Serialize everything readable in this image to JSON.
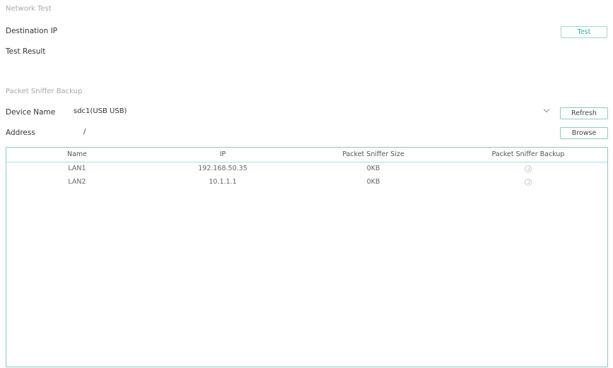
{
  "network_test": {
    "section_title": "Network Test",
    "destination_ip_label": "Destination IP",
    "test_button_label": "Test",
    "test_result_label": "Test Result"
  },
  "packet_sniffer": {
    "section_title": "Packet Sniffer Backup",
    "device_name_label": "Device Name",
    "device_name_value": "sdc1(USB USB)",
    "refresh_button_label": "Refresh",
    "address_label": "Address",
    "address_value": "/",
    "browse_button_label": "Browse"
  },
  "table": {
    "headers": [
      "Name",
      "IP",
      "Packet Sniffer Size",
      "Packet Sniffer Backup"
    ],
    "rows": [
      {
        "name": "LAN1",
        "ip": "192.168.50.35",
        "size": "0KB",
        "backup_icon": "backup-icon"
      },
      {
        "name": "LAN2",
        "ip": "10.1.1.1",
        "size": "0KB",
        "backup_icon": "backup-icon"
      }
    ]
  },
  "colors": {
    "accent": "#2bb3a8",
    "border": "#8ec7c7"
  }
}
